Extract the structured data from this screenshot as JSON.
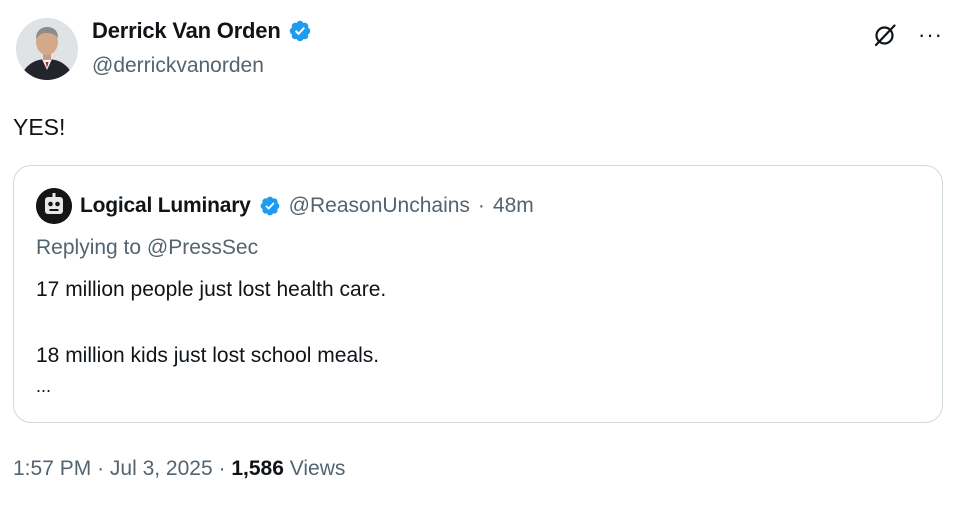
{
  "author": {
    "name": "Derrick Van Orden",
    "handle": "@derrickvanorden"
  },
  "icons": {
    "verified": "verified-badge-icon",
    "grok": "grok-icon",
    "more": "more-icon"
  },
  "more_glyph": "···",
  "tweet": {
    "text": "YES!"
  },
  "quote": {
    "name": "Logical Luminary",
    "handle": "@ReasonUnchains",
    "separator": "·",
    "time": "48m",
    "replying_prefix": "Replying to",
    "replying_handle": "@PressSec",
    "line1": "17 million people just lost health care.",
    "line2": "18 million kids just lost school meals.",
    "ellipsis": "..."
  },
  "meta": {
    "time": "1:57 PM",
    "sep1": "·",
    "date": "Jul 3, 2025",
    "sep2": "·",
    "views_count": "1,586",
    "views_label": "Views"
  },
  "colors": {
    "verified_blue": "#1d9bf0",
    "text_primary": "#0f1419",
    "text_secondary": "#536471",
    "border": "#cfd9de"
  }
}
